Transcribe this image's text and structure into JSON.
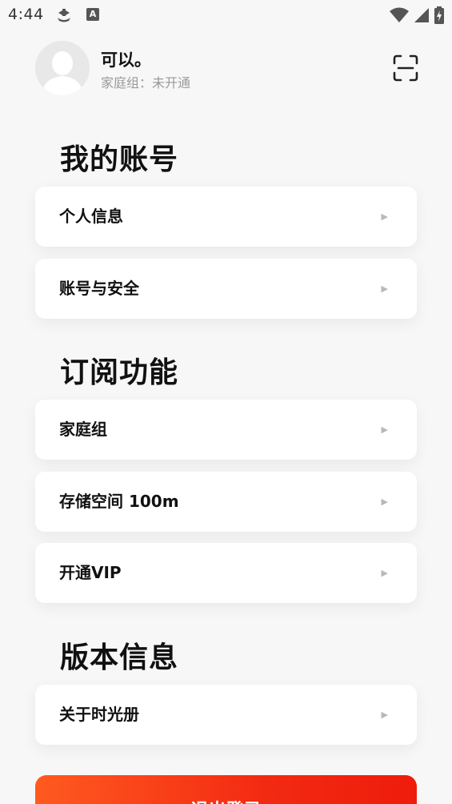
{
  "status_bar": {
    "time": "4:44",
    "a_icon": "A"
  },
  "profile": {
    "name": "可以。",
    "family_status": "家庭组：未开通"
  },
  "sections": [
    {
      "title": "我的账号",
      "items": [
        {
          "label": "个人信息"
        },
        {
          "label": "账号与安全"
        }
      ]
    },
    {
      "title": "订阅功能",
      "items": [
        {
          "label": "家庭组"
        },
        {
          "label": "存储空间 100m"
        },
        {
          "label": "开通VIP"
        }
      ]
    },
    {
      "title": "版本信息",
      "items": [
        {
          "label": "关于时光册"
        }
      ]
    }
  ],
  "arrow_glyph": "▶",
  "logout_label": "退出登录",
  "colors": {
    "background": "#f7f7f7",
    "card": "#ffffff",
    "accent_start": "#ff5a1f",
    "accent_end": "#ee1c0c",
    "muted_text": "#9a9a9a"
  },
  "icons": {
    "scan": "scan-icon",
    "avatar": "avatar-placeholder-icon",
    "wifi": "wifi-icon",
    "signal": "signal-icon",
    "battery": "battery-icon"
  }
}
